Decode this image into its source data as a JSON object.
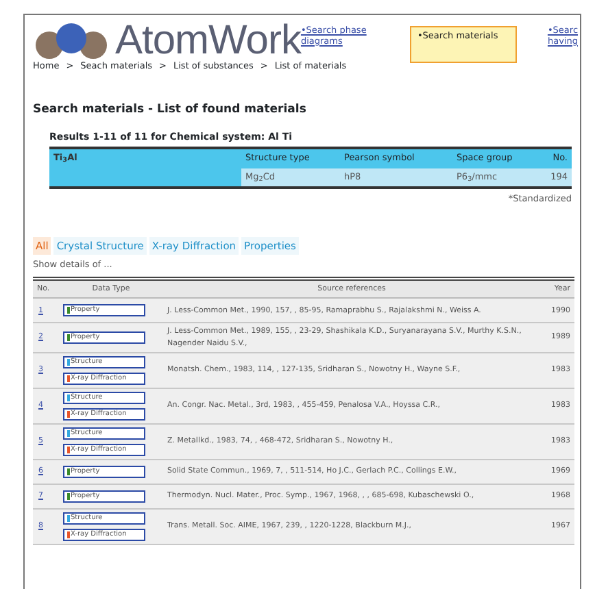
{
  "logo": "AtomWork",
  "nav_links": [
    {
      "label": "•Search phase diagrams",
      "selected": false
    },
    {
      "label": "•Search materials",
      "selected": true
    },
    {
      "label": "•Searc having",
      "selected": false
    }
  ],
  "breadcrumb": [
    "Home",
    "Seach materials",
    "List of substances",
    "List of materials"
  ],
  "breadcrumb_separator": ">",
  "page_title": "Search materials - List of found materials",
  "results_title": "Results 1-11 of 11 for Chemical system: Al Ti",
  "material": {
    "formula": "Ti$_{3}$Al",
    "columns": [
      "Structure type",
      "Pearson symbol",
      "Space group",
      "No."
    ],
    "values": [
      "Mg$_{2}$Cd",
      "hP8",
      "P6$_{3}$/mmc",
      "194"
    ]
  },
  "note": "*Standardized",
  "tabs": [
    {
      "label": "All",
      "selected": true
    },
    {
      "label": "Crystal Structure",
      "selected": false
    },
    {
      "label": "X-ray Diffraction",
      "selected": false
    },
    {
      "label": "Properties",
      "selected": false
    }
  ],
  "details_label": "Show details of ...",
  "table": {
    "columns": [
      "No.",
      "Data Type",
      "Source references",
      "Year"
    ],
    "rows": [
      {
        "no": "1",
        "data_types": [
          {
            "kind": "property",
            "label": "Property"
          }
        ],
        "reference": "J. Less-Common Met., 1990, 157, , 85-95, Ramaprabhu S., Rajalakshmi N., Weiss A.",
        "year": "1990"
      },
      {
        "no": "2",
        "data_types": [
          {
            "kind": "property",
            "label": "Property"
          }
        ],
        "reference": "J. Less-Common Met., 1989, 155, , 23-29, Shashikala K.D., Suryanarayana S.V., Murthy K.S.N., Nagender Naidu S.V.,",
        "year": "1989"
      },
      {
        "no": "3",
        "data_types": [
          {
            "kind": "structure",
            "label": "Structure"
          },
          {
            "kind": "xray",
            "label": "X-ray Diffraction"
          }
        ],
        "reference": "Monatsh. Chem., 1983, 114, , 127-135, Sridharan S., Nowotny H., Wayne S.F.,",
        "year": "1983"
      },
      {
        "no": "4",
        "data_types": [
          {
            "kind": "structure",
            "label": "Structure"
          },
          {
            "kind": "xray",
            "label": "X-ray Diffraction"
          }
        ],
        "reference": "An. Congr. Nac. Metal., 3rd, 1983, , 455-459, Penalosa V.A., Hoyssa C.R.,",
        "year": "1983"
      },
      {
        "no": "5",
        "data_types": [
          {
            "kind": "structure",
            "label": "Structure"
          },
          {
            "kind": "xray",
            "label": "X-ray Diffraction"
          }
        ],
        "reference": "Z. Metallkd., 1983, 74, , 468-472, Sridharan S., Nowotny H.,",
        "year": "1983"
      },
      {
        "no": "6",
        "data_types": [
          {
            "kind": "property",
            "label": "Property"
          }
        ],
        "reference": "Solid State Commun., 1969, 7, , 511-514, Ho J.C., Gerlach P.C., Collings E.W.,",
        "year": "1969"
      },
      {
        "no": "7",
        "data_types": [
          {
            "kind": "property",
            "label": "Property"
          }
        ],
        "reference": "Thermodyn. Nucl. Mater., Proc. Symp., 1967, 1968, , , 685-698, Kubaschewski O.,",
        "year": "1968"
      },
      {
        "no": "8",
        "data_types": [
          {
            "kind": "structure",
            "label": "Structure"
          },
          {
            "kind": "xray",
            "label": "X-ray Diffraction"
          }
        ],
        "reference": "Trans. Metall. Soc. AIME, 1967, 239, , 1220-1228, Blackburn M.J.,",
        "year": "1967"
      }
    ]
  }
}
